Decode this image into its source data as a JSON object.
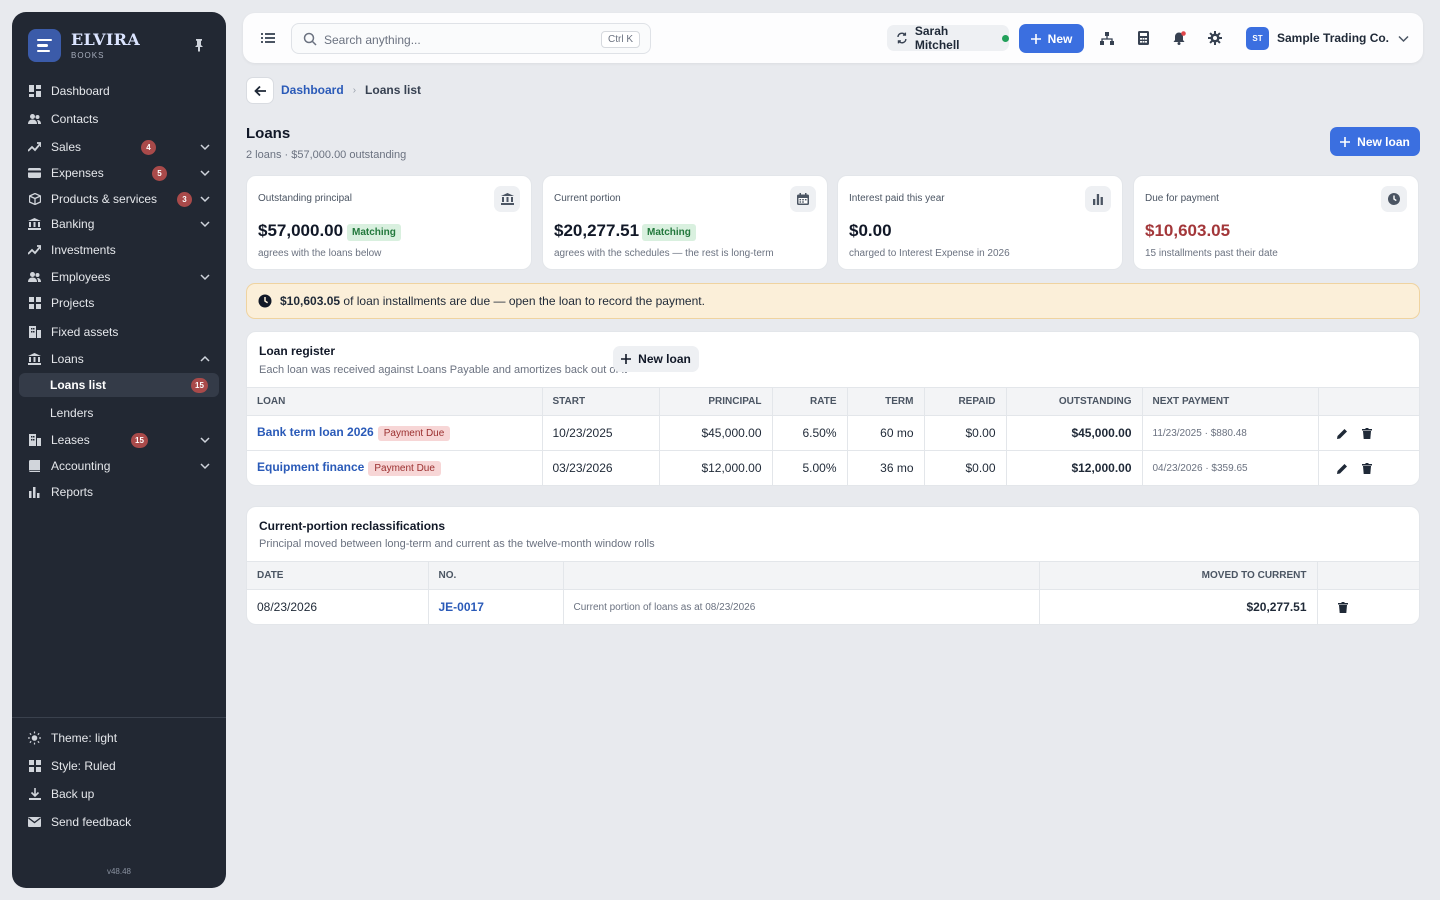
{
  "brand": {
    "name": "ELVIRA",
    "sub": "BOOKS"
  },
  "sidebar": {
    "items": [
      {
        "label": "Dashboard",
        "icon": "dashboard-icon"
      },
      {
        "label": "Contacts",
        "icon": "contacts-icon"
      },
      {
        "label": "Sales",
        "icon": "sales-icon",
        "badge": "4"
      },
      {
        "label": "Expenses",
        "icon": "expenses-icon",
        "badge": "5"
      },
      {
        "label": "Products & services",
        "icon": "products-icon",
        "badge": "3"
      },
      {
        "label": "Banking",
        "icon": "bank-icon"
      },
      {
        "label": "Investments",
        "icon": "investments-icon"
      },
      {
        "label": "Employees",
        "icon": "employees-icon"
      },
      {
        "label": "Projects",
        "icon": "projects-icon"
      },
      {
        "label": "Fixed assets",
        "icon": "fixed-assets-icon"
      },
      {
        "label": "Loans",
        "icon": "loans-icon"
      },
      {
        "label": "Loans list",
        "badge": "15"
      },
      {
        "label": "Lenders"
      },
      {
        "label": "Leases",
        "icon": "leases-icon",
        "badge": "15"
      },
      {
        "label": "Accounting",
        "icon": "accounting-icon"
      },
      {
        "label": "Reports",
        "icon": "reports-icon"
      }
    ],
    "bottom": [
      {
        "label": "Theme: light",
        "icon": "sun-icon"
      },
      {
        "label": "Style: Ruled",
        "icon": "grid-icon"
      },
      {
        "label": "Back up",
        "icon": "download-icon"
      },
      {
        "label": "Send feedback",
        "icon": "mail-icon"
      }
    ],
    "version": "v48.48"
  },
  "topbar": {
    "search_placeholder": "Search anything...",
    "search_shortcut": "Ctrl K",
    "user": "Sarah Mitchell",
    "new_label": "New",
    "company_initials": "ST",
    "company_name": "Sample Trading Co."
  },
  "breadcrumb": {
    "parent": "Dashboard",
    "current": "Loans list"
  },
  "page": {
    "title": "Loans",
    "subtitle": "2 loans · $57,000.00 outstanding",
    "new_loan_label": "New loan"
  },
  "cards": [
    {
      "label": "Outstanding principal",
      "value": "$57,000.00",
      "pill": "Matching",
      "note": "agrees with the loans below",
      "icon": "bank-icon"
    },
    {
      "label": "Current portion",
      "value": "$20,277.51",
      "pill": "Matching",
      "note": "agrees with the schedules — the rest is long-term",
      "icon": "calendar-icon"
    },
    {
      "label": "Interest paid this year",
      "value": "$0.00",
      "note": "charged to Interest Expense in 2026",
      "icon": "bar-chart-icon"
    },
    {
      "label": "Due for payment",
      "value": "$10,603.05",
      "note": "15 installments past their date",
      "icon": "clock-icon"
    }
  ],
  "alert": {
    "amount": "$10,603.05",
    "text": " of loan installments are due — open the loan to record the payment."
  },
  "register": {
    "title": "Loan register",
    "subtitle": "Each loan was received against Loans Payable and amortizes back out of it",
    "new_label": "New loan",
    "columns": [
      "Loan",
      "Start",
      "Principal",
      "Rate",
      "Term",
      "Repaid",
      "Outstanding",
      "Next payment",
      ""
    ],
    "rows": [
      {
        "loan": "Bank term loan 2026",
        "status": "Payment Due",
        "start": "10/23/2025",
        "principal": "$45,000.00",
        "rate": "6.50%",
        "term": "60 mo",
        "repaid": "$0.00",
        "outstanding": "$45,000.00",
        "next": "11/23/2025 · $880.48"
      },
      {
        "loan": "Equipment finance",
        "status": "Payment Due",
        "start": "03/23/2026",
        "principal": "$12,000.00",
        "rate": "5.00%",
        "term": "36 mo",
        "repaid": "$0.00",
        "outstanding": "$12,000.00",
        "next": "04/23/2026 · $359.65"
      }
    ]
  },
  "reclass": {
    "title": "Current-portion reclassifications",
    "subtitle": "Principal moved between long-term and current as the twelve-month window rolls",
    "columns": [
      "Date",
      "No.",
      "",
      "Moved to current",
      ""
    ],
    "rows": [
      {
        "date": "08/23/2026",
        "no": "JE-0017",
        "memo": "Current portion of loans as at 08/23/2026",
        "amount": "$20,277.51"
      }
    ]
  },
  "colors": {
    "accent": "#3b6fe0",
    "sidebar": "#222833",
    "danger": "#a3373a",
    "success": "#22783c"
  }
}
